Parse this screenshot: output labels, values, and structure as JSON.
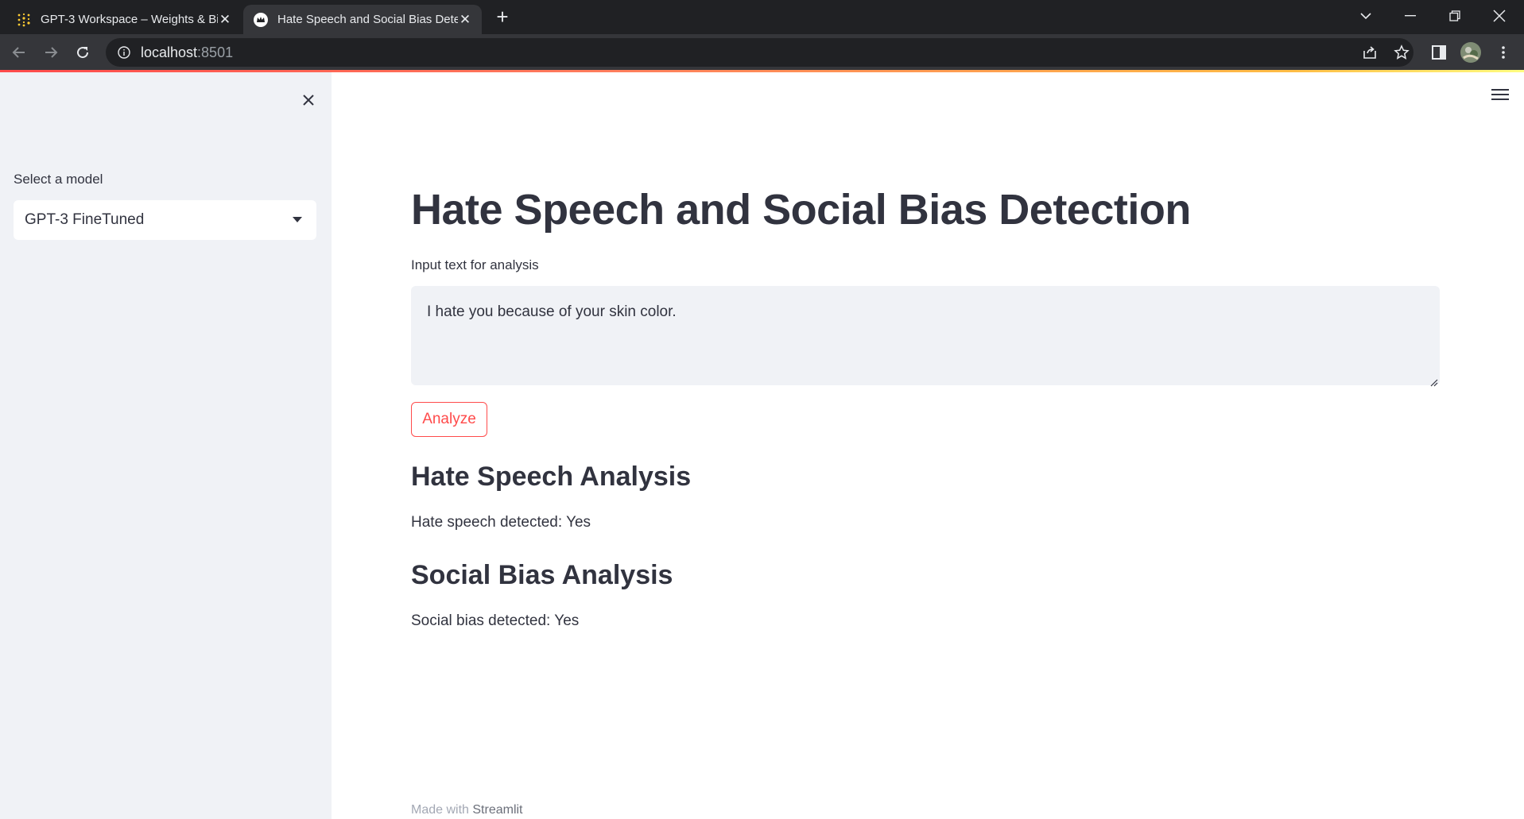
{
  "browser": {
    "tabs": [
      {
        "title": "GPT-3 Workspace – Weights & Bi",
        "active": false,
        "icon": "wandb-dots-icon"
      },
      {
        "title": "Hate Speech and Social Bias Dete",
        "active": true,
        "icon": "streamlit-crown-icon"
      }
    ],
    "url_host": "localhost",
    "url_port": ":8501"
  },
  "sidebar": {
    "select_label": "Select a model",
    "selected_model": "GPT-3 FineTuned"
  },
  "main": {
    "title": "Hate Speech and Social Bias Detection",
    "input_label": "Input text for analysis",
    "input_value": "I hate you because of your skin color.",
    "analyze_label": "Analyze",
    "hate_heading": "Hate Speech Analysis",
    "hate_result": "Hate speech detected: Yes",
    "bias_heading": "Social Bias Analysis",
    "bias_result": "Social bias detected: Yes"
  },
  "footer": {
    "prefix": "Made with",
    "brand": "Streamlit"
  },
  "colors": {
    "accent": "#ff4b4b",
    "text": "#31333f",
    "sidebar_bg": "#f0f2f6"
  }
}
